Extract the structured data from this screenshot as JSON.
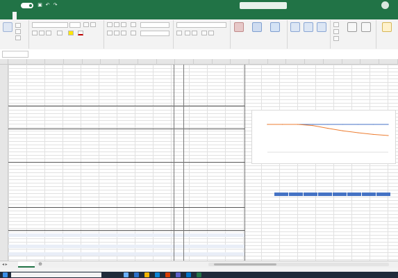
{
  "app": {
    "title": "",
    "autosave_label": "",
    "search_placeholder": "",
    "user_name": "",
    "avatar_initials": ""
  },
  "tabs": [
    {
      "label": ""
    },
    {
      "label": ""
    },
    {
      "label": ""
    },
    {
      "label": ""
    },
    {
      "label": ""
    },
    {
      "label": ""
    },
    {
      "label": ""
    },
    {
      "label": ""
    },
    {
      "label": ""
    }
  ],
  "ribbon": {
    "groups": [
      {
        "label": ""
      },
      {
        "label": ""
      },
      {
        "label": ""
      },
      {
        "label": ""
      },
      {
        "label": ""
      },
      {
        "label": ""
      },
      {
        "label": ""
      },
      {
        "label": ""
      }
    ],
    "font_name": "",
    "font_size": "",
    "number_format": "",
    "big_buttons": [
      {
        "label": ""
      },
      {
        "label": ""
      },
      {
        "label": ""
      },
      {
        "label": ""
      },
      {
        "label": ""
      },
      {
        "label": ""
      },
      {
        "label": ""
      }
    ]
  },
  "formula_bar": {
    "name_box": "",
    "fx": "",
    "content": ""
  },
  "columns": [
    "",
    "",
    "",
    "",
    "",
    "",
    "",
    "",
    "",
    "",
    "",
    "",
    "",
    "",
    "",
    "",
    "",
    "",
    "",
    "",
    ""
  ],
  "sheet_rows": [
    {
      "label": "",
      "values": [
        "",
        "",
        "",
        "",
        "",
        "",
        ""
      ],
      "style": "bold"
    },
    {
      "label": "",
      "values": [
        "",
        "",
        "",
        "",
        "",
        "",
        ""
      ]
    },
    {
      "label": "",
      "values": [
        "",
        "",
        "",
        "",
        "",
        "",
        ""
      ]
    },
    {
      "label": "",
      "values": [
        "",
        "",
        "",
        "",
        "",
        "",
        ""
      ]
    },
    {
      "label": "",
      "values": [
        "",
        "",
        "",
        "",
        "",
        "",
        ""
      ]
    },
    {
      "label": "",
      "values": [
        "",
        "",
        "",
        "",
        "",
        "",
        ""
      ],
      "style": "bold"
    },
    {
      "label": "",
      "values": [
        "",
        "",
        "",
        "",
        "",
        "",
        ""
      ]
    },
    {
      "label": "",
      "values": [
        "",
        "",
        "",
        "",
        "",
        "",
        ""
      ]
    },
    {
      "label": "",
      "values": [
        "",
        "",
        "",
        "",
        "",
        "",
        ""
      ]
    },
    {
      "label": "",
      "values": [
        "",
        "",
        "",
        "",
        "",
        "",
        ""
      ]
    },
    {
      "label": "",
      "values": [
        "",
        "",
        "",
        "",
        "",
        "",
        ""
      ]
    },
    {
      "label": "",
      "values": [
        "",
        "",
        "",
        "",
        "",
        "",
        ""
      ],
      "style": "total"
    },
    {
      "label": "",
      "values": [
        "",
        "",
        "",
        "",
        "",
        "",
        ""
      ]
    },
    {
      "label": "",
      "values": [
        "",
        "",
        "",
        "",
        "",
        "",
        ""
      ]
    },
    {
      "label": "",
      "values": [
        "",
        "",
        "",
        "",
        "",
        "",
        ""
      ]
    },
    {
      "label": "",
      "values": [
        "",
        "",
        "",
        "",
        "",
        "",
        ""
      ]
    },
    {
      "label": "",
      "values": [
        "",
        "",
        "",
        "",
        "",
        "",
        ""
      ]
    },
    {
      "label": "",
      "values": [
        "",
        "",
        "",
        "",
        "",
        "",
        ""
      ],
      "style": "total"
    },
    {
      "label": "",
      "values": [
        "",
        "",
        "",
        "",
        "",
        "",
        ""
      ]
    },
    {
      "label": "",
      "values": [
        "",
        "",
        "",
        "",
        "",
        "",
        ""
      ]
    },
    {
      "label": "",
      "values": [
        "",
        "",
        "",
        "",
        "",
        "",
        ""
      ]
    },
    {
      "label": "",
      "values": [
        "",
        "",
        "",
        "",
        "",
        "",
        ""
      ]
    },
    {
      "label": "",
      "values": [
        "",
        "",
        "",
        "",
        "",
        "",
        ""
      ],
      "style": "bold"
    },
    {
      "label": "",
      "values": [
        "",
        "",
        "",
        "",
        "",
        "",
        ""
      ]
    },
    {
      "label": "",
      "values": [
        "",
        "",
        "",
        "",
        "",
        "",
        ""
      ]
    },
    {
      "label": "",
      "values": [
        "",
        "",
        "",
        "",
        "",
        "",
        ""
      ]
    },
    {
      "label": "",
      "values": [
        "",
        "",
        "",
        "",
        "",
        "",
        ""
      ],
      "style": "total"
    },
    {
      "label": "",
      "values": [
        "",
        "",
        "",
        "",
        "",
        "",
        ""
      ]
    },
    {
      "label": "",
      "values": [
        "",
        "",
        "",
        "",
        "",
        "",
        ""
      ]
    },
    {
      "label": "",
      "values": [
        "",
        "",
        "",
        "",
        "",
        "",
        ""
      ]
    },
    {
      "label": "",
      "values": [
        "",
        "",
        "",
        "",
        "",
        "",
        ""
      ]
    },
    {
      "label": "",
      "values": [
        "",
        "",
        "",
        "",
        "",
        "",
        ""
      ]
    },
    {
      "label": "",
      "values": [
        "",
        "",
        "",
        "",
        "",
        "",
        ""
      ]
    },
    {
      "label": "",
      "values": [
        "",
        "",
        "",
        "",
        "",
        "",
        ""
      ],
      "style": "bold"
    },
    {
      "label": "",
      "values": [
        "",
        "",
        "",
        "",
        "",
        "",
        ""
      ]
    },
    {
      "label": "",
      "values": [
        "",
        "",
        "",
        "",
        "",
        "",
        ""
      ]
    },
    {
      "label": "",
      "values": [
        "",
        "",
        "",
        "",
        "",
        "",
        ""
      ]
    },
    {
      "label": "",
      "values": [
        "",
        "",
        "",
        "",
        "",
        "",
        ""
      ]
    },
    {
      "label": "",
      "values": [
        "",
        "",
        "",
        "",
        "",
        "",
        ""
      ],
      "style": "total"
    },
    {
      "label": "",
      "values": [
        "",
        "",
        "",
        "",
        "",
        "",
        ""
      ]
    },
    {
      "label": "",
      "values": [
        "",
        "",
        "",
        "",
        "",
        "",
        ""
      ]
    },
    {
      "label": "",
      "values": [
        "",
        "",
        "",
        "",
        "",
        "",
        ""
      ]
    },
    {
      "label": "",
      "values": [
        "",
        "",
        "",
        "",
        "",
        "",
        ""
      ]
    },
    {
      "label": "",
      "values": [
        "",
        "",
        "",
        "",
        "",
        "",
        ""
      ]
    },
    {
      "label": "",
      "values": [
        "",
        "",
        "",
        "",
        "",
        "",
        ""
      ],
      "style": "total"
    },
    {
      "label": "",
      "values": [
        "",
        "",
        "",
        "",
        "",
        "",
        ""
      ],
      "style": "hl"
    },
    {
      "label": "",
      "values": [
        "",
        "",
        "",
        "",
        "",
        "",
        ""
      ]
    },
    {
      "label": "",
      "values": [
        "",
        "",
        "",
        "",
        "",
        "",
        ""
      ]
    },
    {
      "label": "",
      "values": [
        "",
        "",
        "",
        "",
        "",
        "",
        ""
      ],
      "style": "hl"
    },
    {
      "label": "",
      "values": [
        "",
        "",
        "",
        "",
        "",
        "",
        ""
      ]
    },
    {
      "label": "",
      "values": [
        "",
        "",
        "",
        "",
        "",
        "",
        ""
      ],
      "style": "hl"
    },
    {
      "label": "",
      "values": [
        "",
        "",
        "",
        "",
        "",
        "",
        ""
      ]
    }
  ],
  "chart_data": {
    "type": "line",
    "title": "",
    "x": [
      "",
      "",
      "",
      "",
      "",
      "",
      "",
      "",
      ""
    ],
    "series": [
      {
        "name": "",
        "color": "#4472c4",
        "values": [
          1.0,
          1.0,
          1.0,
          1.0,
          1.0,
          1.0,
          1.0,
          1.0,
          1.0
        ]
      },
      {
        "name": "",
        "color": "#ed7d31",
        "values": [
          1.0,
          1.0,
          1.0,
          0.96,
          0.86,
          0.77,
          0.7,
          0.64,
          0.6
        ]
      }
    ],
    "ylim": [
      0,
      1.2
    ],
    "grid": false
  },
  "mini_table": {
    "label": "",
    "headers": [
      "",
      "",
      "",
      "",
      "",
      "",
      "",
      ""
    ],
    "values": [
      "",
      "",
      "",
      "",
      "",
      "",
      "",
      ""
    ]
  },
  "mini_row_text": "",
  "sheets": [
    {
      "name": ""
    }
  ],
  "status": {
    "ready": "",
    "zoom": ""
  },
  "taskbar": {
    "search_placeholder": "",
    "system_text": "",
    "time": ""
  },
  "colors": {
    "accent": "#217346",
    "chart_blue": "#4472c4",
    "chart_orange": "#ed7d31"
  }
}
